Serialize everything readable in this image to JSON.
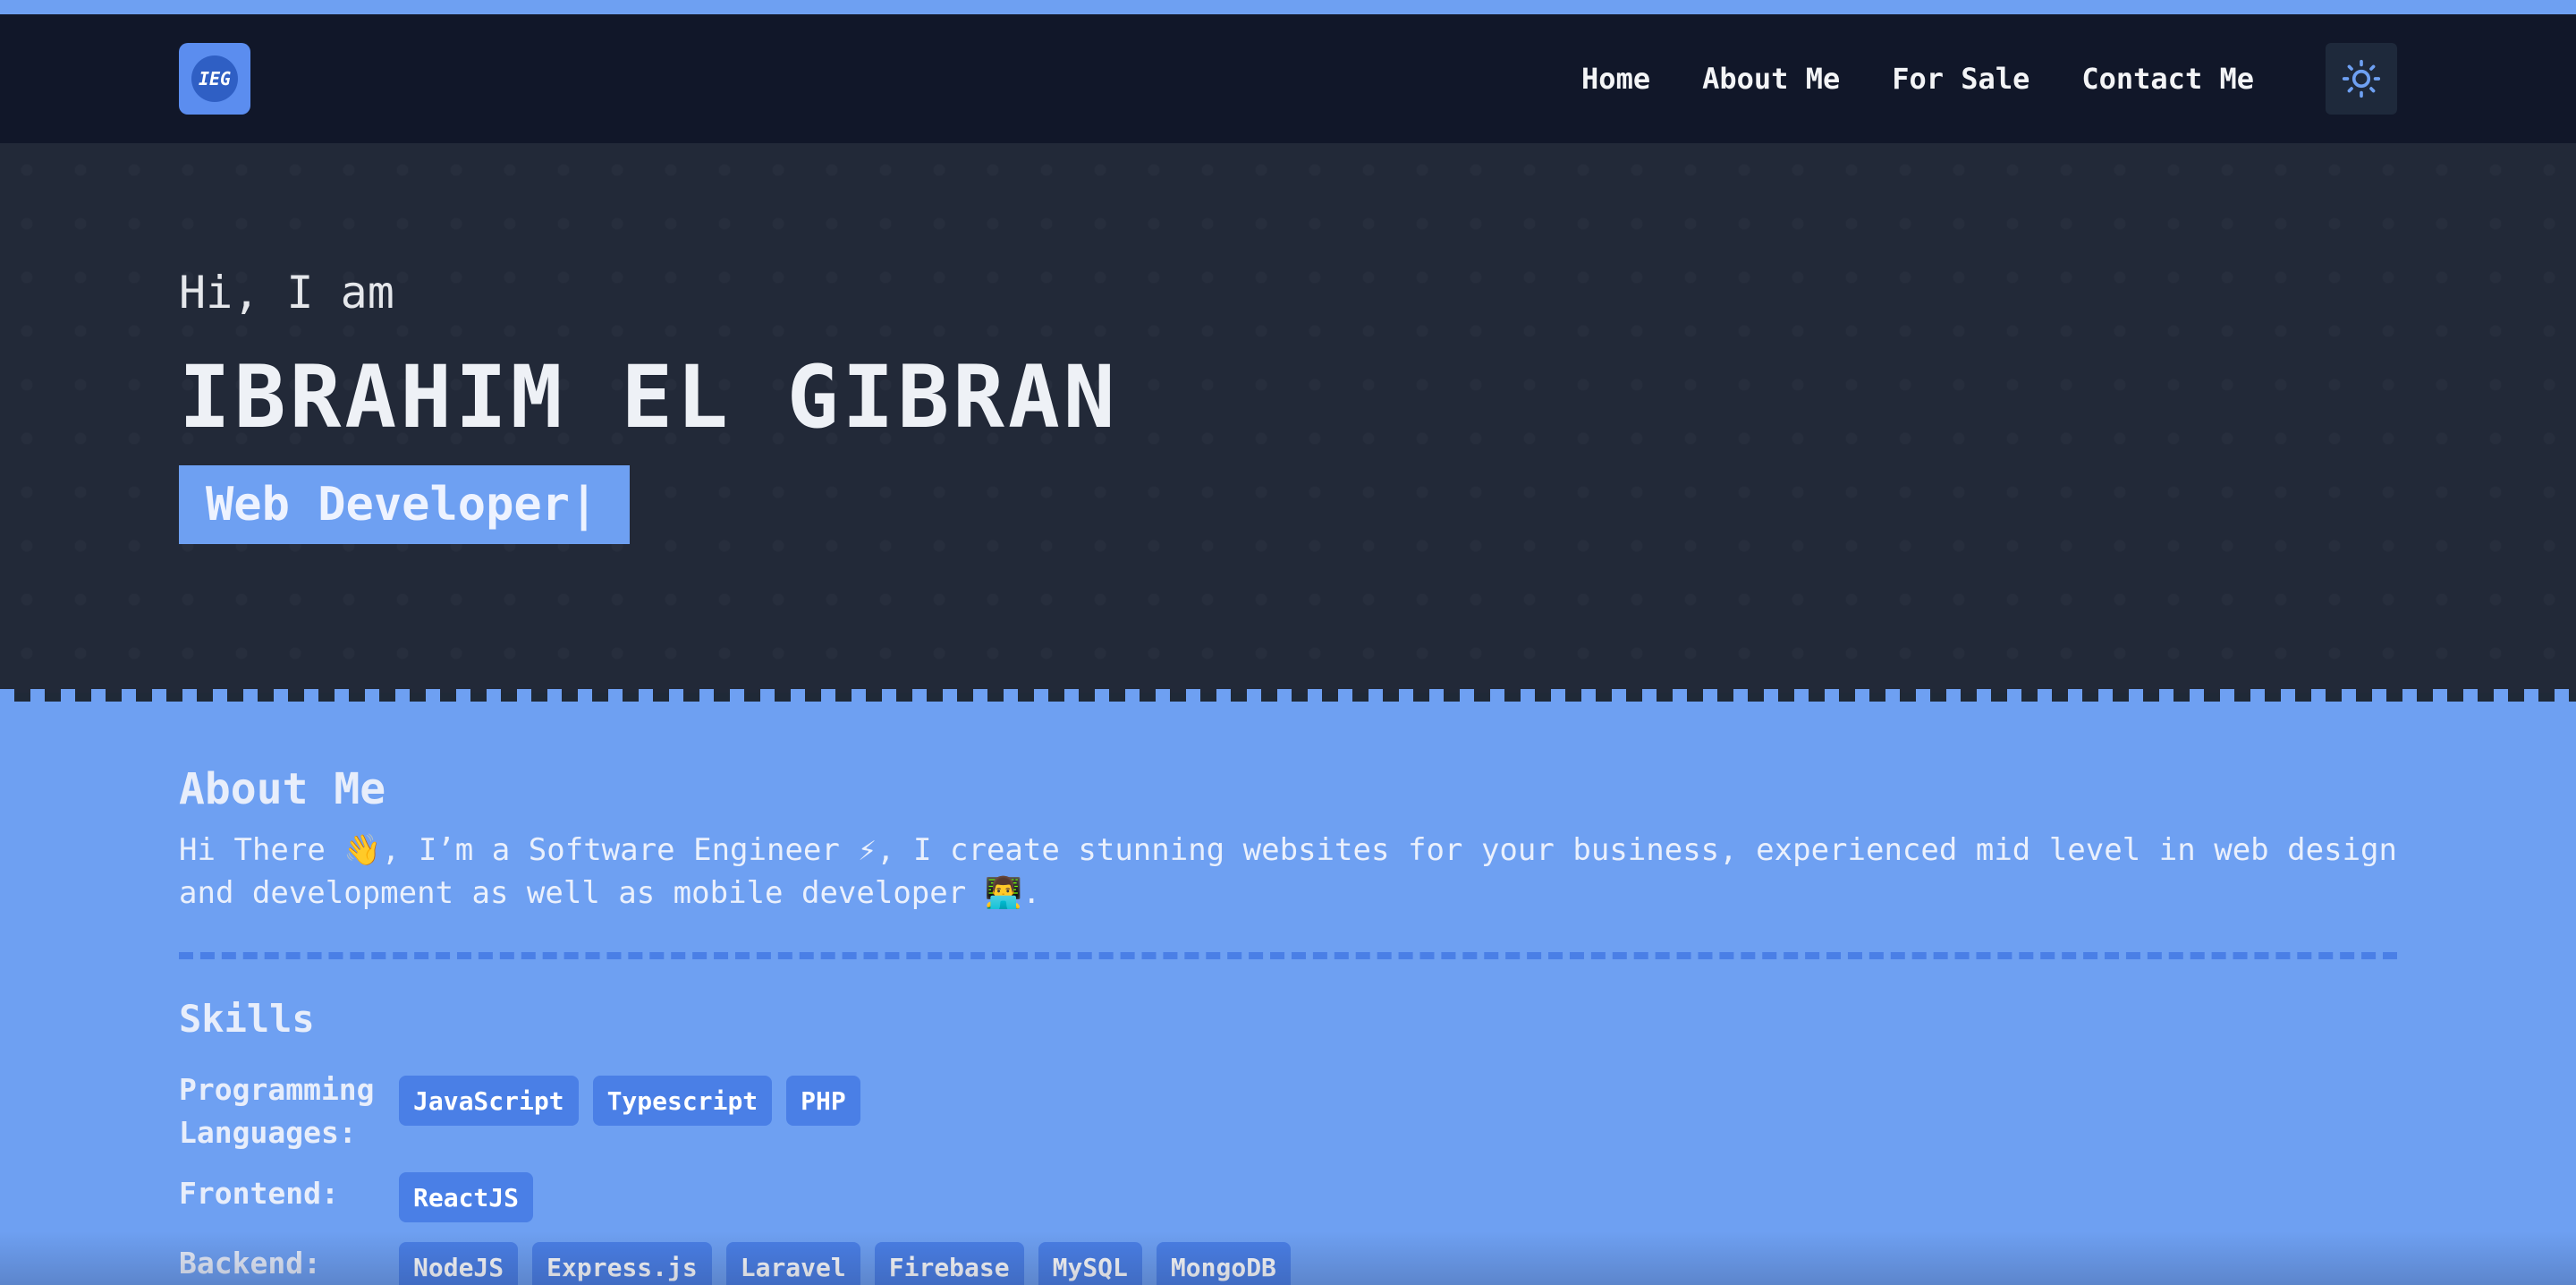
{
  "colors": {
    "accent": "#6ea0f2",
    "nav_bg": "#111729",
    "hero_bg": "#222938",
    "tag_bg": "#4a7fe6"
  },
  "header": {
    "logo_icon": "logo-icon",
    "logo_text": "IEG",
    "nav": [
      {
        "label": "Home"
      },
      {
        "label": "About Me"
      },
      {
        "label": "For Sale"
      },
      {
        "label": "Contact Me"
      }
    ],
    "theme_toggle_icon": "sun-icon"
  },
  "hero": {
    "greeting": "Hi, I am",
    "name": "IBRAHIM EL GIBRAN",
    "role": "Web Developer|"
  },
  "about": {
    "title": "About Me",
    "text": "Hi There 👋, I’m a Software Engineer ⚡, I create stunning websites for your business, experienced mid level in web design and development as well as mobile developer 👨‍💻."
  },
  "skills": {
    "title": "Skills",
    "groups": [
      {
        "label": "Programming Languages:",
        "items": [
          "JavaScript",
          "Typescript",
          "PHP"
        ]
      },
      {
        "label": "Frontend:",
        "items": [
          "ReactJS"
        ]
      },
      {
        "label": "Backend:",
        "items": [
          "NodeJS",
          "Express.js",
          "Laravel",
          "Firebase",
          "MySQL",
          "MongoDB"
        ]
      }
    ]
  }
}
